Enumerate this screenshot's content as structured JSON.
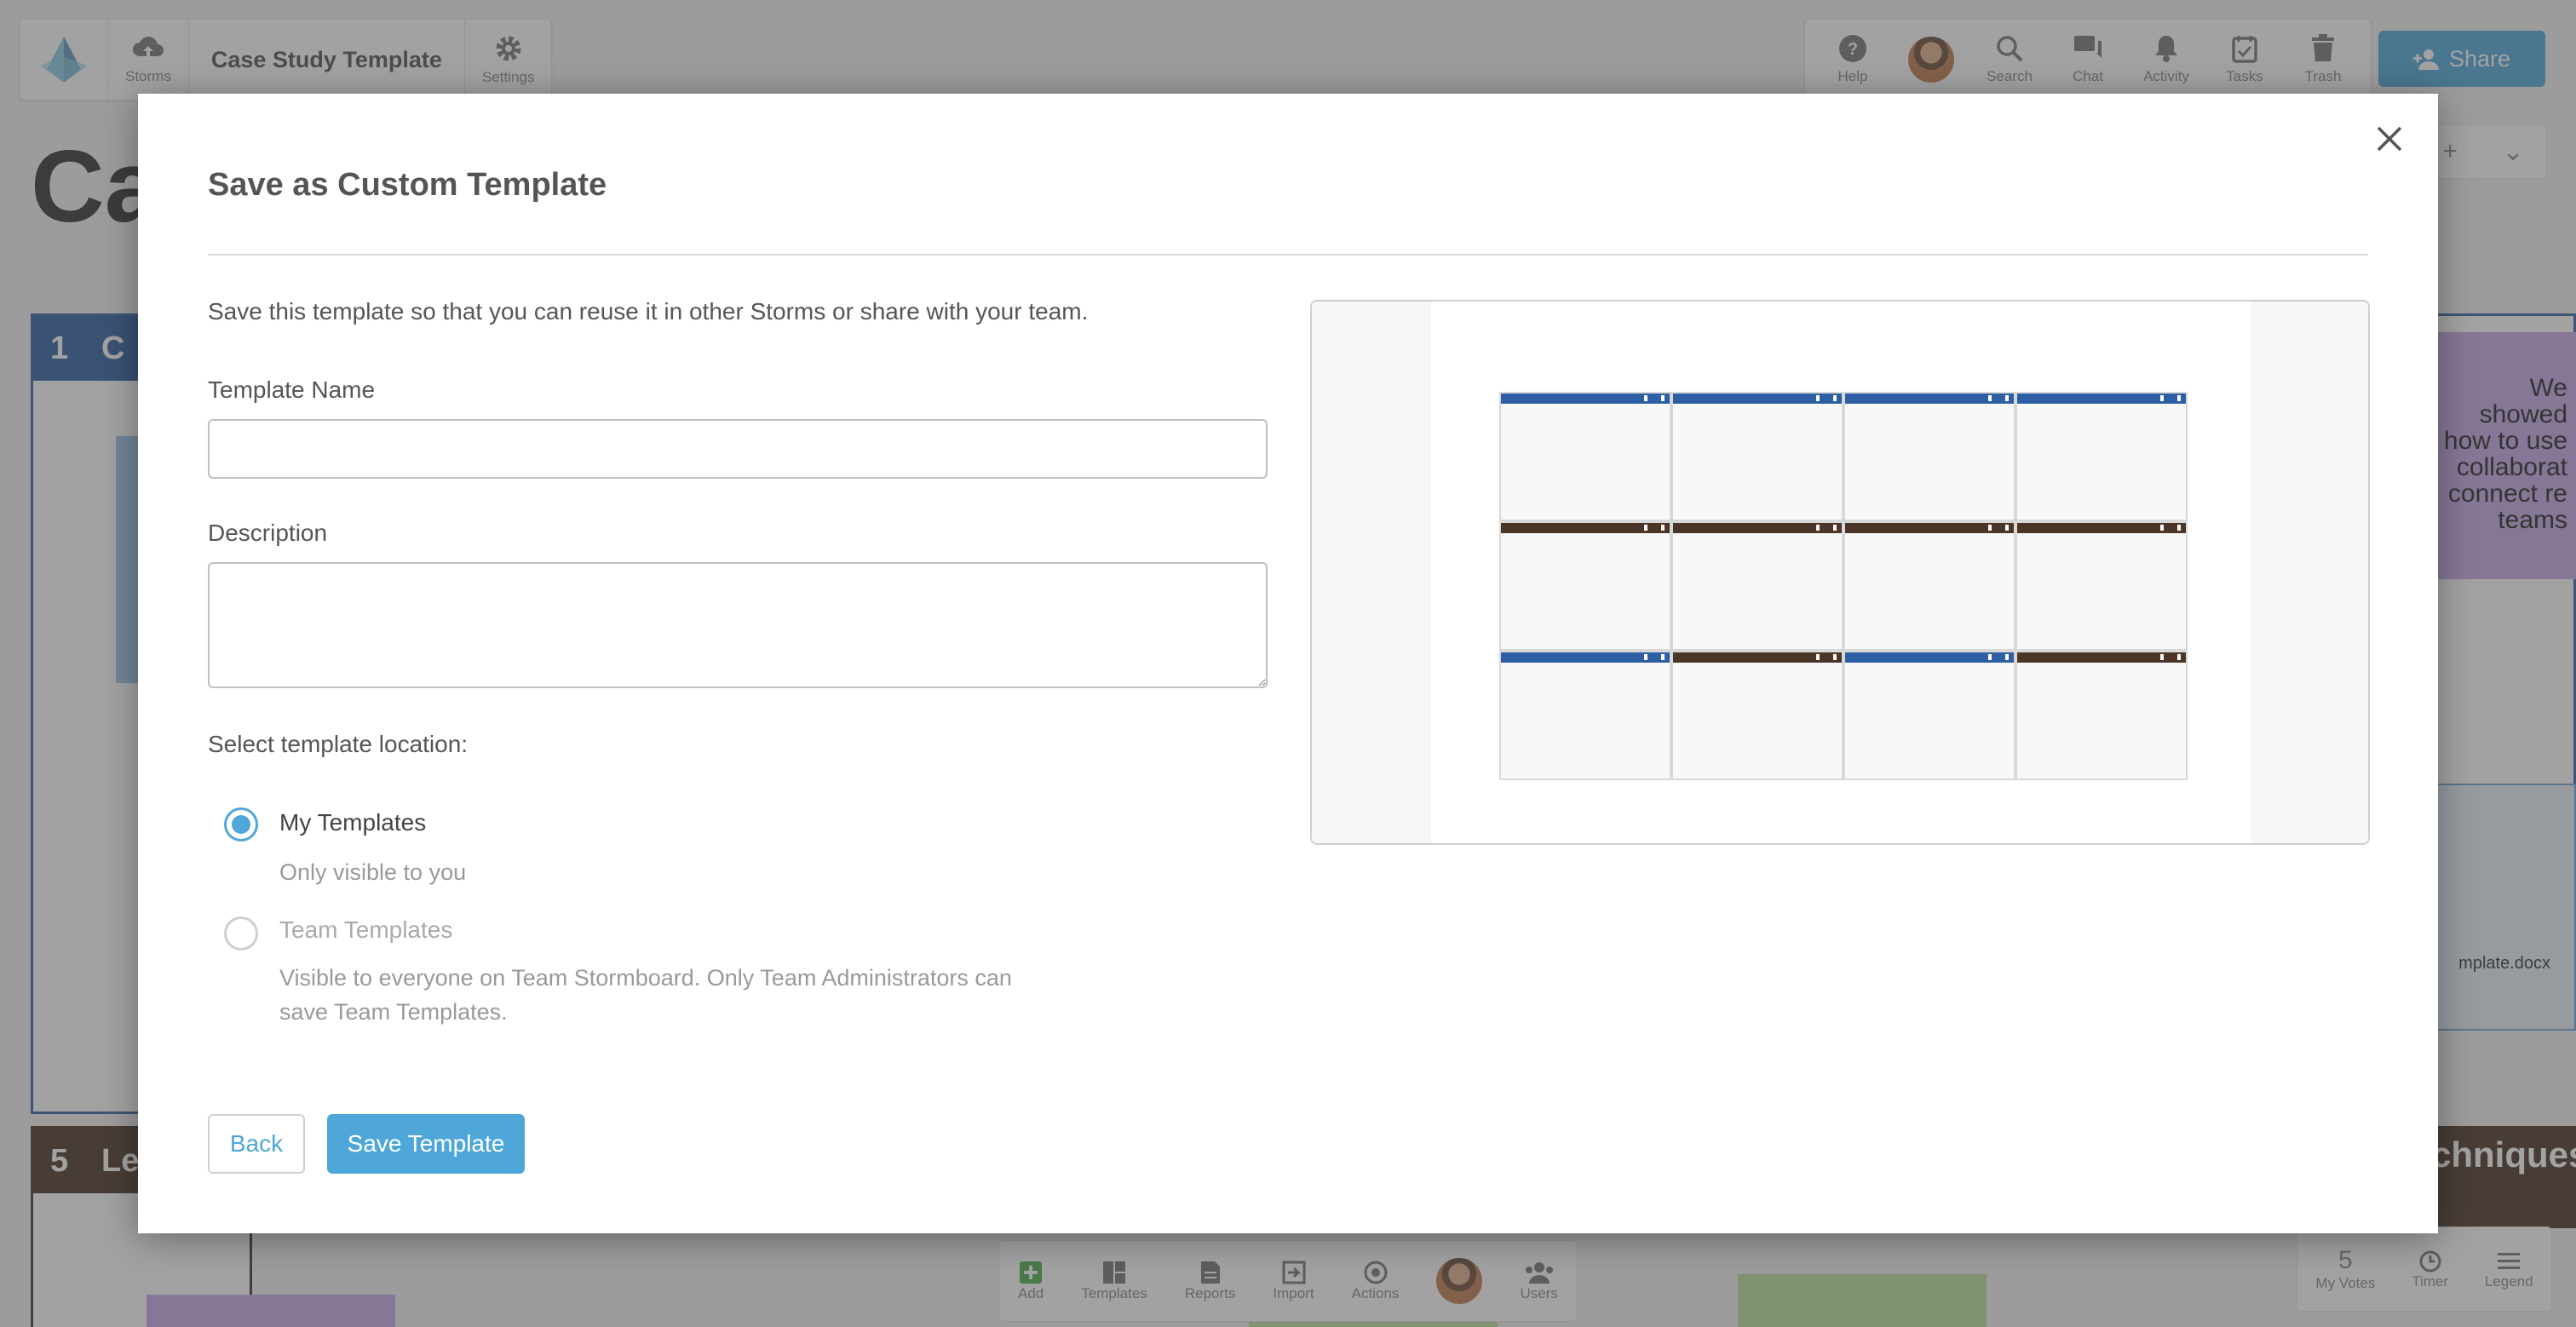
{
  "app": {
    "title": "Case Study Template",
    "nav_left": [
      {
        "label": "Storms",
        "icon": "cloud-upload-icon"
      },
      {
        "label": "Settings",
        "icon": "gear-icon"
      }
    ],
    "nav_right": [
      {
        "label": "Help",
        "icon": "help-icon"
      },
      {
        "label": "Search",
        "icon": "search-icon"
      },
      {
        "label": "Chat",
        "icon": "chat-icon"
      },
      {
        "label": "Activity",
        "icon": "bell-icon"
      },
      {
        "label": "Tasks",
        "icon": "tasks-icon"
      },
      {
        "label": "Trash",
        "icon": "trash-icon"
      }
    ],
    "share_label": "Share",
    "big_title": "Ca",
    "section1": {
      "num": "1",
      "title": "C"
    },
    "section5": {
      "num": "5",
      "title": "Le"
    },
    "right_card_text": "We showed how to use collaborat connect re teams",
    "right_doc_name": "mplate.docx",
    "right_section_title": "chniques",
    "bottom_bar": [
      {
        "label": "Add",
        "icon": "add-icon"
      },
      {
        "label": "Templates",
        "icon": "templates-icon"
      },
      {
        "label": "Reports",
        "icon": "reports-icon"
      },
      {
        "label": "Import",
        "icon": "import-icon"
      },
      {
        "label": "Actions",
        "icon": "actions-icon"
      },
      {
        "label": "Users",
        "icon": "users-icon"
      }
    ],
    "bottom_right": [
      {
        "label": "My Votes",
        "value": "5"
      },
      {
        "label": "Timer",
        "icon": "timer-icon"
      },
      {
        "label": "Legend",
        "icon": "legend-icon"
      }
    ]
  },
  "modal": {
    "title": "Save as Custom Template",
    "intro": "Save this template so that you can reuse it in other Storms or share with your team.",
    "name_label": "Template Name",
    "name_value": "",
    "description_label": "Description",
    "description_value": "",
    "location_label": "Select template location:",
    "options": [
      {
        "title": "My Templates",
        "subtitle": "Only visible to you",
        "checked": true,
        "disabled": false
      },
      {
        "title": "Team Templates",
        "subtitle": "Visible to everyone on Team Stormboard. Only Team Administrators can save Team Templates.",
        "checked": false,
        "disabled": true
      }
    ],
    "back_label": "Back",
    "save_label": "Save Template",
    "preview_rows": [
      [
        "blue",
        "blue",
        "blue",
        "blue"
      ],
      [
        "brown",
        "brown",
        "brown",
        "brown"
      ],
      [
        "blue",
        "brown",
        "blue",
        "brown"
      ]
    ],
    "colors": {
      "accent": "#4ea7d8",
      "section_blue": "#2e5ea3",
      "section_brown": "#4a3526"
    }
  }
}
